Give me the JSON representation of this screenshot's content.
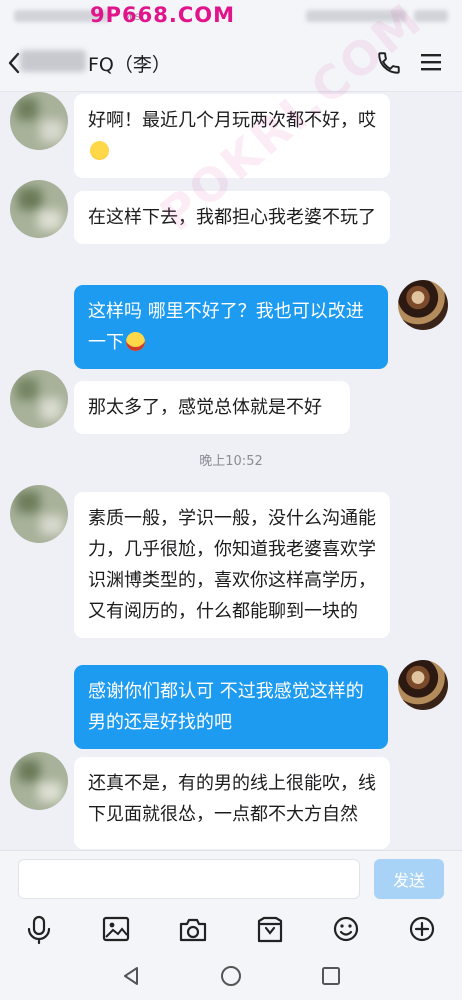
{
  "watermark": {
    "brand": "9P668.COM",
    "diagonal": "POKRI.COM"
  },
  "status_bar": {
    "network": "M/S"
  },
  "header": {
    "title": "FQ（李）"
  },
  "messages": [
    {
      "from": "friend",
      "text": "好啊！最近几个月玩两次都不好，哎",
      "emoji": "crying-face"
    },
    {
      "from": "friend",
      "text": "在这样下去，我都担心我老婆不玩了"
    },
    {
      "from": "me",
      "text": "这样吗 哪里不好了？我也可以改进一下",
      "emoji": "grinning-face"
    },
    {
      "from": "friend",
      "text": "那太多了，感觉总体就是不好"
    },
    {
      "from": "friend",
      "text": "素质一般，学识一般，没什么沟通能力，几乎很尬，你知道我老婆喜欢学识渊博类型的，喜欢你这样高学历，又有阅历的，什么都能聊到一块的"
    },
    {
      "from": "me",
      "text": "感谢你们都认可 不过我感觉这样的男的还是好找的吧"
    },
    {
      "from": "friend",
      "text": "还真不是，有的男的线上很能吹，线下见面就很怂，一点都不大方自然"
    }
  ],
  "timestamp": "晚上10:52",
  "composer": {
    "placeholder": "",
    "send_label": "发送"
  },
  "toolbar": [
    "microphone-icon",
    "image-icon",
    "camera-icon",
    "folder-icon",
    "emoji-icon",
    "plus-icon"
  ],
  "colors": {
    "outgoing_bubble": "#1d9bf0",
    "send_disabled": "#a9d3f6",
    "brand_watermark": "#e2148c"
  }
}
